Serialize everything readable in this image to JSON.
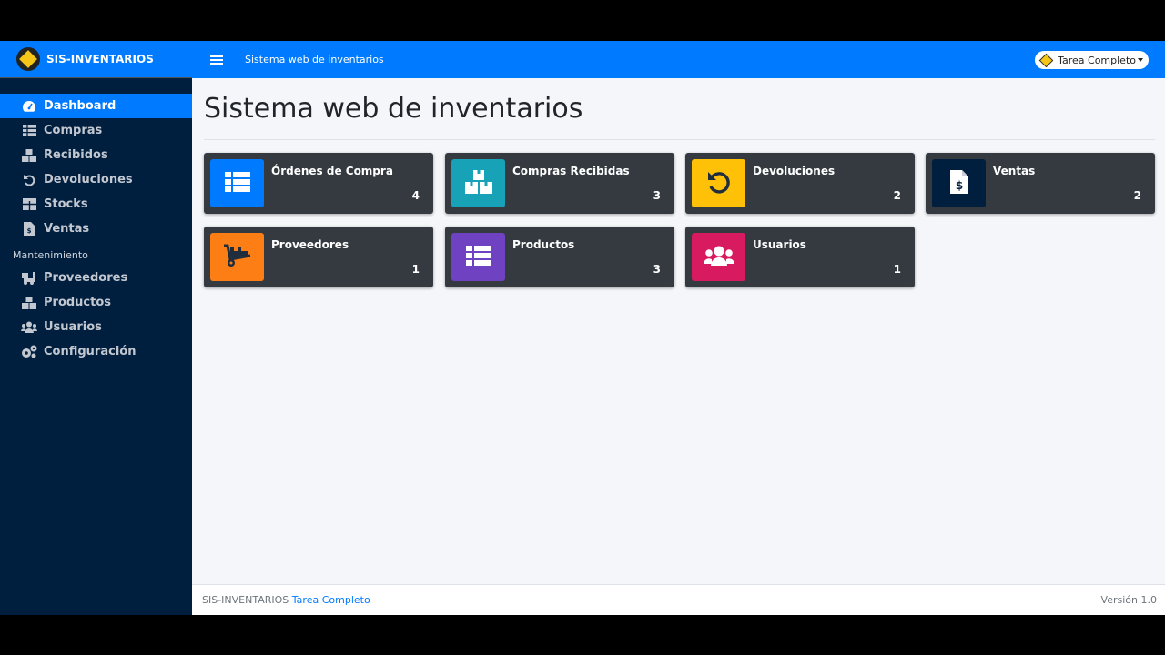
{
  "brand": {
    "name": "SIS-INVENTARIOS"
  },
  "topbar": {
    "link": "Sistema web de inventarios",
    "user": "Tarea Completo"
  },
  "sidebar": {
    "items": [
      {
        "label": "Dashboard",
        "icon": "tachometer-icon",
        "active": true
      },
      {
        "label": "Compras",
        "icon": "table-icon"
      },
      {
        "label": "Recibidos",
        "icon": "boxes-icon"
      },
      {
        "label": "Devoluciones",
        "icon": "undo-icon"
      },
      {
        "label": "Stocks",
        "icon": "grid-icon"
      },
      {
        "label": "Ventas",
        "icon": "invoice-icon"
      }
    ],
    "section_header": "Mantenimiento",
    "maintenance": [
      {
        "label": "Proveedores",
        "icon": "truck-icon"
      },
      {
        "label": "Productos",
        "icon": "boxes-icon"
      },
      {
        "label": "Usuarios",
        "icon": "users-icon"
      },
      {
        "label": "Configuración",
        "icon": "cogs-icon"
      }
    ]
  },
  "main": {
    "title": "Sistema web de inventarios",
    "cards": [
      {
        "title": "Órdenes de Compra",
        "count": "4",
        "color": "#007bff",
        "icon": "list-icon"
      },
      {
        "title": "Compras Recibidas",
        "count": "3",
        "color": "#17a2b8",
        "icon": "boxes-icon"
      },
      {
        "title": "Devoluciones",
        "count": "2",
        "color": "#ffc107",
        "icon": "undo-icon"
      },
      {
        "title": "Ventas",
        "count": "2",
        "color": "#001f3f",
        "icon": "invoice-dollar-icon"
      },
      {
        "title": "Proveedores",
        "count": "1",
        "color": "#fd7e14",
        "icon": "dolly-icon"
      },
      {
        "title": "Productos",
        "count": "3",
        "color": "#6f42c1",
        "icon": "list-icon"
      },
      {
        "title": "Usuarios",
        "count": "1",
        "color": "#d81b60",
        "icon": "users-icon"
      }
    ]
  },
  "footer": {
    "left": "SIS-INVENTARIOS",
    "link": "Tarea Completo",
    "right": "Versión 1.0"
  }
}
